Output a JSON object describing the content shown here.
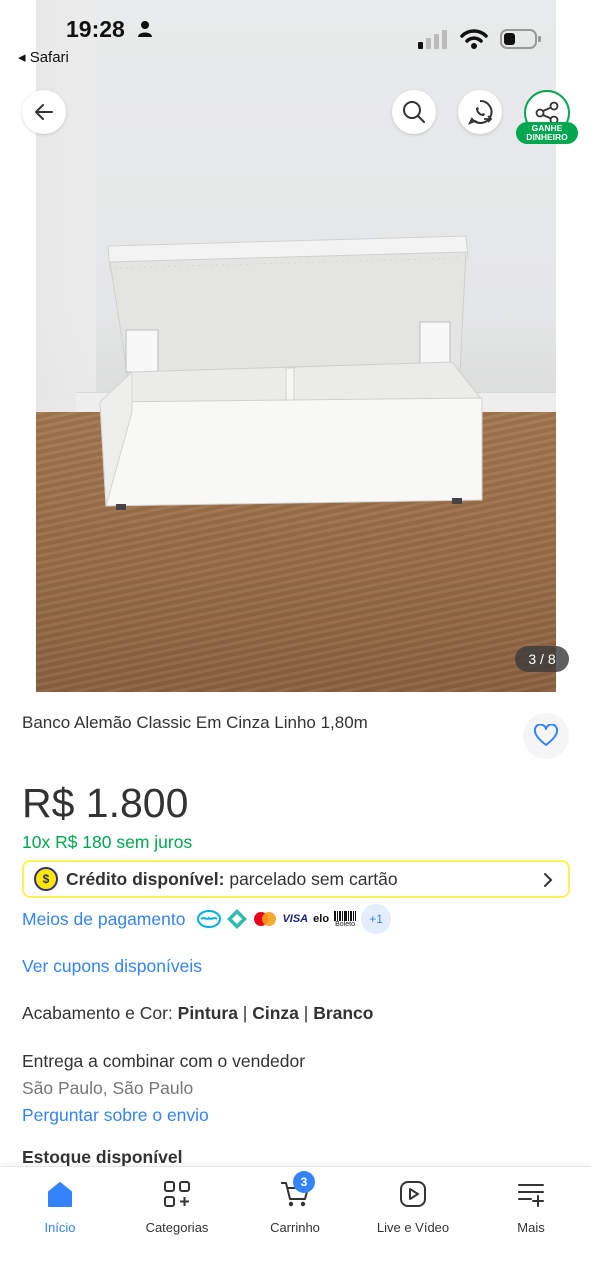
{
  "status_bar": {
    "time": "19:28",
    "back_app": "◂ Safari"
  },
  "gallery": {
    "counter": "3 / 8",
    "share_badge_line1": "GANHE",
    "share_badge_line2": "DINHEIRO"
  },
  "product": {
    "title": "Banco Alemão Classic Em Cinza Linho 1,80m",
    "price": "R$ 1.800",
    "installments": "10x R$ 180 sem juros"
  },
  "credit": {
    "strong": "Crédito disponível:",
    "text": " parcelado sem cartão"
  },
  "payments": {
    "link": "Meios de pagamento",
    "methods": [
      "mercado-pago",
      "pix",
      "mastercard",
      "visa",
      "elo",
      "boleto"
    ],
    "visa_label": "VISA",
    "elo_label": "elo",
    "boleto_label": "Boleto",
    "more": "+1"
  },
  "coupons_link": "Ver cupons disponíveis",
  "finish": {
    "label": "Acabamento e Cor: ",
    "value1": "Pintura",
    "sep1": " | ",
    "value2": "Cinza",
    "sep2": " | ",
    "value3": "Branco"
  },
  "delivery": {
    "text": "Entrega a combinar com o vendedor",
    "location": "São Paulo, São Paulo",
    "ask_link": "Perguntar sobre o envio"
  },
  "stock": "Estoque disponível",
  "tabbar": {
    "items": [
      {
        "label": "Início",
        "icon": "home-icon"
      },
      {
        "label": "Categorias",
        "icon": "grid-plus-icon"
      },
      {
        "label": "Carrinho",
        "icon": "cart-icon"
      },
      {
        "label": "Live e Vídeo",
        "icon": "play-icon"
      },
      {
        "label": "Mais",
        "icon": "menu-plus-icon"
      }
    ],
    "cart_count": "3"
  },
  "colors": {
    "accent_blue": "#3483fa",
    "green": "#00a650",
    "yellow_banner": "#fff159"
  }
}
